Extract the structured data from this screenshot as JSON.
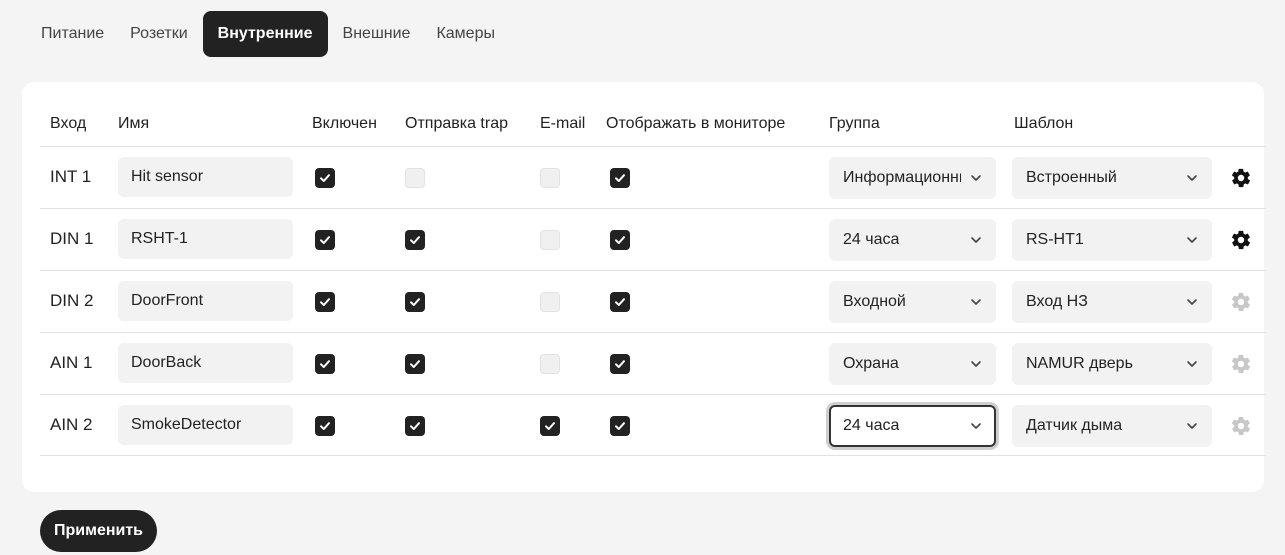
{
  "tabs": [
    {
      "label": "Питание",
      "active": false
    },
    {
      "label": "Розетки",
      "active": false
    },
    {
      "label": "Внутренние",
      "active": true
    },
    {
      "label": "Внешние",
      "active": false
    },
    {
      "label": "Камеры",
      "active": false
    }
  ],
  "table": {
    "headers": {
      "input": "Вход",
      "name": "Имя",
      "enabled": "Включен",
      "trap": "Отправка trap",
      "email": "E-mail",
      "monitor": "Отображать в мониторе",
      "group": "Группа",
      "template": "Шаблон"
    },
    "rows": [
      {
        "input": "INT 1",
        "name": "Hit sensor",
        "enabled": true,
        "trap": false,
        "email": false,
        "monitor": true,
        "group": "Информационный",
        "template": "Встроенный",
        "gear_active": true,
        "trap_disabled": true,
        "email_disabled": true
      },
      {
        "input": "DIN 1",
        "name": "RSHT-1",
        "enabled": true,
        "trap": true,
        "email": false,
        "monitor": true,
        "group": "24 часа",
        "template": "RS-HT1",
        "gear_active": true,
        "trap_disabled": false,
        "email_disabled": true
      },
      {
        "input": "DIN 2",
        "name": "DoorFront",
        "enabled": true,
        "trap": true,
        "email": false,
        "monitor": true,
        "group": "Входной",
        "template": "Вход НЗ",
        "gear_active": false,
        "trap_disabled": false,
        "email_disabled": true
      },
      {
        "input": "AIN 1",
        "name": "DoorBack",
        "enabled": true,
        "trap": true,
        "email": false,
        "monitor": true,
        "group": "Охрана",
        "template": "NAMUR дверь",
        "gear_active": false,
        "trap_disabled": false,
        "email_disabled": true
      },
      {
        "input": "AIN 2",
        "name": "SmokeDetector",
        "enabled": true,
        "trap": true,
        "email": true,
        "monitor": true,
        "group": "24 часа",
        "template": "Датчик дыма",
        "gear_active": false,
        "trap_disabled": false,
        "email_disabled": false,
        "group_focused": true
      }
    ]
  },
  "apply_label": "Применить",
  "colors": {
    "accent": "#222222",
    "gear_active": "#111111",
    "gear_inactive": "#c8c8c8"
  },
  "icons": {
    "checkbox": "checkmark-icon",
    "dropdown": "chevron-down-icon",
    "settings": "gear-icon"
  }
}
